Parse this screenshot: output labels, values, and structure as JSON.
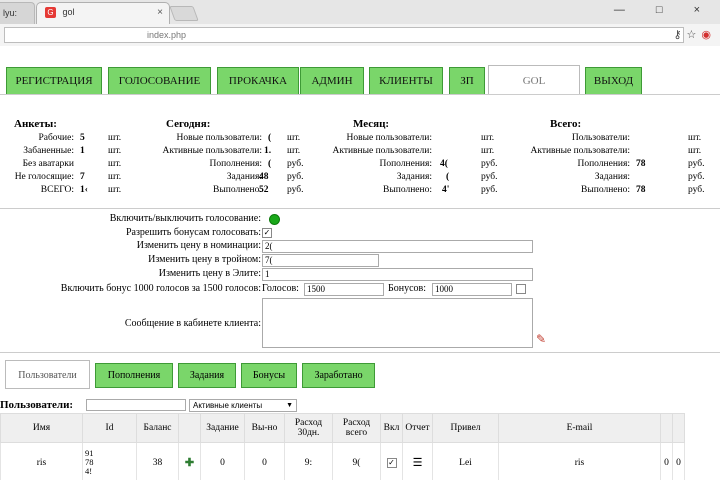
{
  "browser": {
    "tab_inactive_label": "lyu:",
    "tab_active_label": "gol",
    "tab_close": "×",
    "favicon_letter": "G",
    "url": "index.php",
    "window_controls": "— □ ×",
    "addr_key_icon": "⚷",
    "addr_star_icon": "☆",
    "addr_stop_icon": "◉"
  },
  "nav": {
    "items": [
      {
        "label": "РЕГИСТРАЦИЯ",
        "active": false
      },
      {
        "label": "ГОЛОСОВАНИЕ",
        "active": false
      },
      {
        "label": "ПРОКАЧКА",
        "active": false
      },
      {
        "label": "АДМИН",
        "active": false
      },
      {
        "label": "КЛИЕНТЫ",
        "active": false
      },
      {
        "label": "ЗП",
        "active": false
      },
      {
        "label": "GOL",
        "active": true
      },
      {
        "label": "ВЫХОД",
        "active": false
      }
    ],
    "accent": "#7ad66a"
  },
  "stats": {
    "ankety": {
      "title": "Анкеты:",
      "rows": [
        {
          "label": "Рабочие:",
          "value": "5",
          "unit": "шт."
        },
        {
          "label": "Забаненные:",
          "value": "1",
          "unit": "шт."
        },
        {
          "label": "Без аватарки",
          "value": "",
          "unit": "шт."
        },
        {
          "label": "Не голосящие:",
          "value": "7",
          "unit": "шт."
        },
        {
          "label": "ВСЕГО:",
          "value": "1‹",
          "unit": "шт."
        }
      ]
    },
    "today": {
      "title": "Сегодня:",
      "rows": [
        {
          "label": "Новые пользователи:",
          "value": "(",
          "unit": "шт."
        },
        {
          "label": "Активные пользователи:",
          "value": "1.",
          "unit": "шт."
        },
        {
          "label": "Пополнения:",
          "value": "(",
          "unit": "руб."
        },
        {
          "label": "Задания:",
          "value": "48",
          "unit": "руб."
        },
        {
          "label": "Выполнено:",
          "value": "52",
          "unit": "руб."
        }
      ]
    },
    "month": {
      "title": "Месяц:",
      "rows": [
        {
          "label": "Новые пользователи:",
          "value": "",
          "unit": "шт."
        },
        {
          "label": "Активные пользователи:",
          "value": "",
          "unit": "шт."
        },
        {
          "label": "Пополнения:",
          "value": "4(",
          "unit": "руб."
        },
        {
          "label": "Задания:",
          "value": "(",
          "unit": "руб."
        },
        {
          "label": "Выполнено:",
          "value": "4'",
          "unit": "руб."
        }
      ]
    },
    "total": {
      "title": "Всего:",
      "rows": [
        {
          "label": "Пользователи:",
          "value": "",
          "unit": "шт."
        },
        {
          "label": "Активные пользователи:",
          "value": "",
          "unit": "шт."
        },
        {
          "label": "Пополнения:",
          "value": "78",
          "unit": "руб."
        },
        {
          "label": "Задания:",
          "value": "",
          "unit": "руб."
        },
        {
          "label": "Выполнено:",
          "value": "78",
          "unit": "руб."
        }
      ]
    }
  },
  "form": {
    "toggle_voting_label": "Включить/выключить голосование:",
    "toggle_voting_status": "#1aa81a",
    "allow_bonus_label": "Разрешить бонусам голосовать:",
    "allow_bonus_checked": "✓",
    "nomination_price_label": "Изменить цену в номинации:",
    "nomination_price_value": "2(",
    "triple_price_label": "Изменить цену в тройном:",
    "triple_price_value": "7(",
    "elite_price_label": "Изменить цену в Элите:",
    "elite_price_value": "1",
    "bonus_label": "Включить бонус 1000 голосов за 1500 голосов:",
    "votes_label": "Голосов:",
    "votes_value": "1500",
    "bonuses_label": "Бонусов:",
    "bonuses_value": "1000",
    "client_message_label": "Сообщение в кабинете клиента:",
    "pencil_icon": "✎"
  },
  "subtabs": [
    {
      "label": "Пользователи",
      "active": true
    },
    {
      "label": "Пополнения",
      "active": false
    },
    {
      "label": "Задания",
      "active": false
    },
    {
      "label": "Бонусы",
      "active": false
    },
    {
      "label": "Заработано",
      "active": false
    }
  ],
  "users": {
    "title": "Пользователи:",
    "filter_value": "Активные клиенты",
    "filter_arrow": "▼",
    "columns": [
      "Имя",
      "Id",
      "Баланс",
      "",
      "Задание",
      "Вы-но",
      "Расход 30дн.",
      "Расход всего",
      "Вкл",
      "Отчет",
      "Привел",
      "E-mail",
      "",
      ""
    ],
    "rows": [
      {
        "name": "ris",
        "id_lines": [
          "91",
          "78",
          "4!"
        ],
        "id_marker": "1",
        "balance": "38",
        "action_icon": "✚",
        "task": "0",
        "done": "0",
        "spend30": "9:",
        "spend_total": "9(",
        "enabled": "✓",
        "report_icon": "☰",
        "referrer": "Lei",
        "email": "ris",
        "c1": "0",
        "c2": "0"
      }
    ]
  }
}
